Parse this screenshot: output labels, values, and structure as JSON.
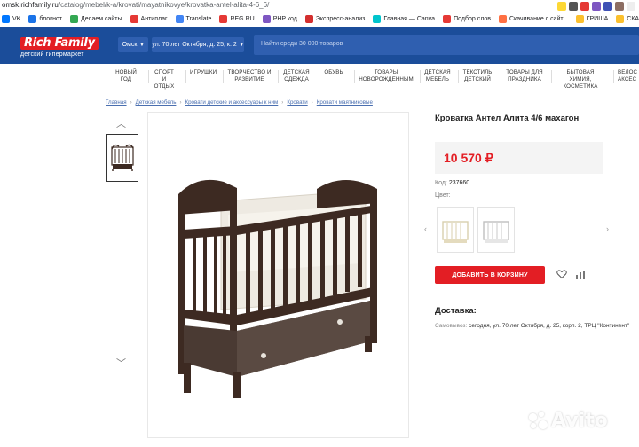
{
  "browser": {
    "url_host": "omsk.richfamily.ru",
    "url_path": "/catalog/mebel/k-a/krovati/mayatnikovye/krovatka-antel-alita-4-6_6/",
    "bookmarks": [
      {
        "label": "VK",
        "color": "#0077ff"
      },
      {
        "label": "блокнот",
        "color": "#1a73e8"
      },
      {
        "label": "Делаем сайты",
        "color": "#34a853"
      },
      {
        "label": "Антиплаг",
        "color": "#e53935"
      },
      {
        "label": "Translate",
        "color": "#4285f4"
      },
      {
        "label": "REG.RU",
        "color": "#e53935"
      },
      {
        "label": "PHP код",
        "color": "#7e57c2"
      },
      {
        "label": "Экспресс-анализ",
        "color": "#d32f2f"
      },
      {
        "label": "Главная — Canva",
        "color": "#00c4cc"
      },
      {
        "label": "Подбор слов",
        "color": "#e53935"
      },
      {
        "label": "Скачивание с сайт...",
        "color": "#ff7043"
      },
      {
        "label": "ГРИША",
        "color": "#fbc02d"
      },
      {
        "label": "СКАЧИВАНИЕ",
        "color": "#fbc02d"
      }
    ]
  },
  "header": {
    "logo_main": "Rich Family",
    "logo_sub": "детский гипермаркет",
    "city": "Омск",
    "address": "ул. 70 лет Октября, д. 25, к. 2",
    "search_placeholder": "Найти среди 30 000 товаров"
  },
  "nav": [
    {
      "label": "НОВЫЙ ГОД",
      "lines": [
        "НОВЫЙ",
        "ГОД"
      ]
    },
    {
      "label": "СПОРТ И ОТДЫХ",
      "lines": [
        "СПОРТ И",
        "ОТДЫХ"
      ]
    },
    {
      "label": "ИГРУШКИ",
      "lines": [
        "ИГРУШКИ"
      ]
    },
    {
      "label": "ТВОРЧЕСТВО И РАЗВИТИЕ",
      "lines": [
        "ТВОРЧЕСТВО И",
        "РАЗВИТИЕ"
      ]
    },
    {
      "label": "ДЕТСКАЯ ОДЕЖДА",
      "lines": [
        "ДЕТСКАЯ",
        "ОДЕЖДА"
      ]
    },
    {
      "label": "ОБУВЬ",
      "lines": [
        "ОБУВЬ"
      ]
    },
    {
      "label": "ТОВАРЫ НОВОРОЖДЕННЫМ",
      "lines": [
        "ТОВАРЫ",
        "НОВОРОЖДЕННЫМ"
      ]
    },
    {
      "label": "ДЕТСКАЯ МЕБЕЛЬ",
      "lines": [
        "ДЕТСКАЯ",
        "МЕБЕЛЬ"
      ]
    },
    {
      "label": "ТЕКСТИЛЬ ДЕТСКИЙ",
      "lines": [
        "ТЕКСТИЛЬ",
        "ДЕТСКИЙ"
      ]
    },
    {
      "label": "ТОВАРЫ ДЛЯ ПРАЗДНИКА",
      "lines": [
        "ТОВАРЫ ДЛЯ",
        "ПРАЗДНИКА"
      ]
    },
    {
      "label": "БЫТОВАЯ ХИМИЯ, КОСМЕТИКА",
      "lines": [
        "БЫТОВАЯ ХИМИЯ,",
        "КОСМЕТИКА"
      ]
    },
    {
      "label": "ВЕЛОС АКСЕС",
      "lines": [
        "ВЕЛОС",
        "АКСЕС"
      ]
    }
  ],
  "breadcrumbs": [
    "Главная",
    "Детская мебель",
    "Кровати детские и аксессуары к ним",
    "Кровати",
    "Кровати маятниковые"
  ],
  "product": {
    "title": "Кроватка Антел Алита 4/6 махагон",
    "price": "10 570 ₽",
    "code_label": "Код:",
    "code_value": "237660",
    "color_label": "Цвет:",
    "cart_button": "Добавить в корзину",
    "delivery_title": "Доставка:",
    "pickup_label": "Самовывоз:",
    "pickup_value": "сегодня, ул. 70 лет Октября, д. 25, корп. 2, ТРЦ \"Континент\""
  },
  "watermark": "Avito",
  "colors": {
    "header_blue": "#1b4d9a",
    "brand_red": "#e31e24",
    "crib_brown": "#3d2a22"
  }
}
